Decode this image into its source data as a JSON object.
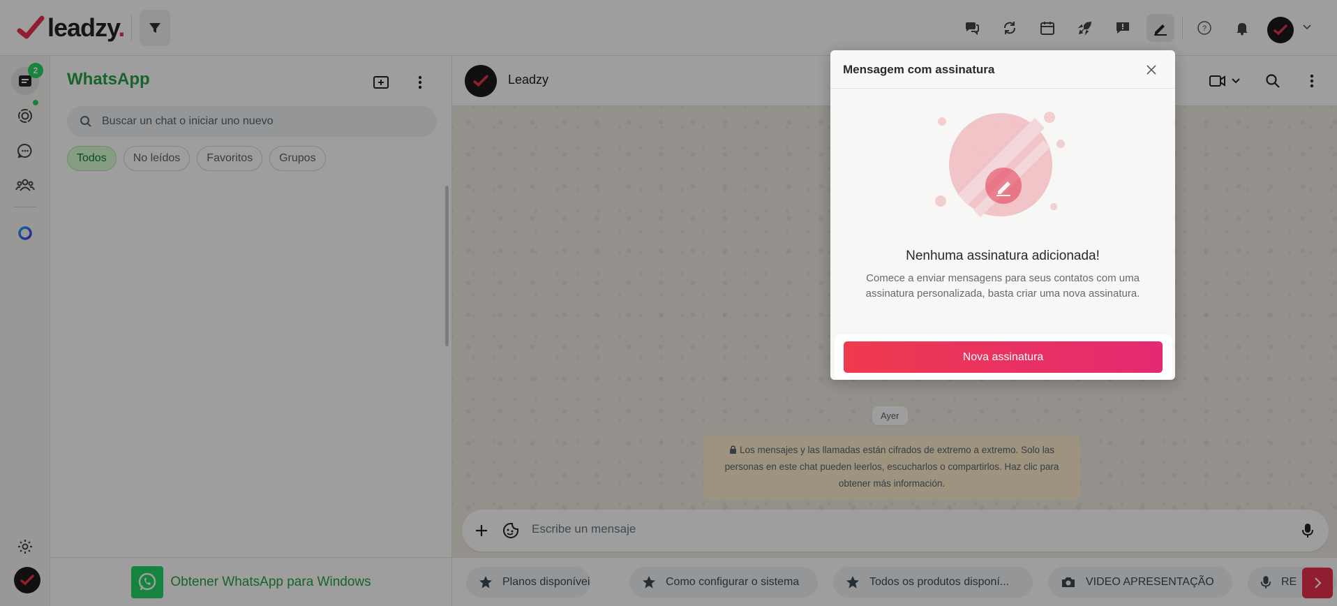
{
  "brand": {
    "name": "leadzy",
    "dot": ".",
    "accent": "#e8304e",
    "wa_green": "#25a244"
  },
  "rail": {
    "badge_count": "2"
  },
  "panel": {
    "title": "WhatsApp",
    "search_placeholder": "Buscar un chat o iniciar uno nuevo",
    "chips": [
      "Todos",
      "No leídos",
      "Favoritos",
      "Grupos"
    ],
    "get_app": "Obtener WhatsApp para Windows"
  },
  "conversation": {
    "contact_name": "Leadzy",
    "day_label": "Ayer",
    "encryption_notice": "Los mensajes y las llamadas están cifrados de extremo a extremo. Solo las personas en este chat pueden leerlos, escucharlos o compartirlos. Haz clic para obtener más información.",
    "composer_placeholder": "Escribe un mensaje"
  },
  "quick_replies": [
    {
      "label": "Planos disponíveis",
      "icon": "star-icon"
    },
    {
      "label": "Como configurar o sistema",
      "icon": "star-icon"
    },
    {
      "label": "Todos os produtos disponí...",
      "icon": "star-icon"
    },
    {
      "label": "VIDEO APRESENTAÇÃO",
      "icon": "camera-icon"
    },
    {
      "label": "RE",
      "icon": "mic-icon"
    }
  ],
  "modal": {
    "title": "Mensagem com assinatura",
    "empty_title": "Nenhuma assinatura adicionada!",
    "empty_desc": "Comece a enviar mensagens para seus contatos com uma assinatura personalizada, basta criar uma nova assinatura.",
    "cta_label": "Nova assinatura"
  }
}
